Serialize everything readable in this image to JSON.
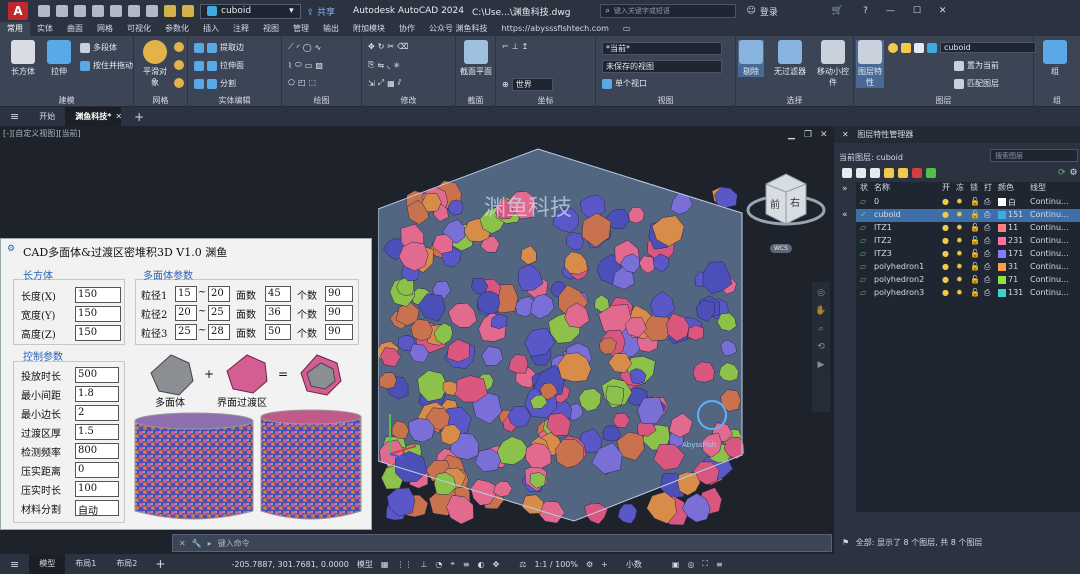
{
  "titlebar": {
    "logo": "A",
    "workspace": "cuboid",
    "share": "共享",
    "app_title": "Autodesk AutoCAD 2024",
    "file_path": "C:\\Use...\\渊鱼科技.dwg",
    "search_placeholder": "键入关键字或短语",
    "login": "登录"
  },
  "ribbon_tabs": [
    "常用",
    "实体",
    "曲面",
    "网格",
    "可视化",
    "参数化",
    "插入",
    "注释",
    "视图",
    "管理",
    "输出",
    "附加模块",
    "协作",
    "公众号 渊鱼科技",
    "https://abysssfishtech.com"
  ],
  "ribbon": {
    "groups": [
      {
        "label": "建模",
        "big": [
          "长方体",
          "拉伸"
        ],
        "small": [
          "多段体",
          "按住并拖动"
        ]
      },
      {
        "label": "网格",
        "big": [
          "平滑对象"
        ]
      },
      {
        "label": "实体编辑",
        "small": [
          "提取边",
          "拉伸面",
          "分割"
        ]
      },
      {
        "label": "绘图"
      },
      {
        "label": "修改"
      },
      {
        "label": "截面",
        "big": [
          "截面平面"
        ]
      },
      {
        "label": "坐标",
        "small": [
          "世界"
        ]
      },
      {
        "label": "视图",
        "small": [
          "*当前*",
          "未保存的视图",
          "单个视口"
        ]
      },
      {
        "label": "选择",
        "big": [
          "剔除",
          "无过滤器",
          "移动小控件"
        ]
      },
      {
        "label": "图层",
        "big": [
          "图层特性"
        ],
        "small": [
          "cuboid",
          "置为当前",
          "匹配图层"
        ]
      },
      {
        "label": "组",
        "big": [
          "组"
        ]
      }
    ]
  },
  "doc_tabs": [
    "开始",
    "渊鱼科技*"
  ],
  "viewport": {
    "label": "[-][自定义视图][当前]",
    "viewcube_front": "前",
    "viewcube_right": "右",
    "wcs": "WCS",
    "watermark": "渊鱼科技",
    "brand": "AbyssFish"
  },
  "panel": {
    "title": "CAD多面体&过渡区密堆积3D V1.0 渊鱼",
    "cuboid_title": "长方体",
    "length_label": "长度(X)",
    "length": "150",
    "width_label": "宽度(Y)",
    "width": "150",
    "height_label": "高度(Z)",
    "height": "150",
    "poly_title": "多面体参数",
    "rows": [
      {
        "label": "粒径1",
        "min": "15",
        "max": "20",
        "faces_label": "面数",
        "faces": "45",
        "count_label": "个数",
        "count": "90"
      },
      {
        "label": "粒径2",
        "min": "20",
        "max": "25",
        "faces_label": "面数",
        "faces": "36",
        "count_label": "个数",
        "count": "90"
      },
      {
        "label": "粒径3",
        "min": "25",
        "max": "28",
        "faces_label": "面数",
        "faces": "50",
        "count_label": "个数",
        "count": "90"
      }
    ],
    "tilde": "~",
    "ctrl_title": "控制参数",
    "controls": [
      {
        "label": "投放时长",
        "value": "500"
      },
      {
        "label": "最小间距",
        "value": "1.8"
      },
      {
        "label": "最小边长",
        "value": "2"
      },
      {
        "label": "过渡区厚",
        "value": "1.5"
      },
      {
        "label": "检测频率",
        "value": "800"
      },
      {
        "label": "压实距离",
        "value": "0"
      },
      {
        "label": "压实时长",
        "value": "100"
      },
      {
        "label": "材料分割",
        "value": "自动"
      }
    ],
    "plus": "+",
    "equals": "=",
    "cap_poly": "多面体",
    "cap_itz": "界面过渡区"
  },
  "layers": {
    "header": "图层特性管理器",
    "current": "当前图层: cuboid",
    "search": "搜索图层",
    "cols": [
      "状",
      "名称",
      "开",
      "冻",
      "锁",
      "打",
      "颜色",
      "线型"
    ],
    "items": [
      {
        "name": "0",
        "color": "白",
        "hex": "#ffffff",
        "ltype": "Continu...",
        "sel": false
      },
      {
        "name": "cuboid",
        "color": "151",
        "hex": "#3fa9e0",
        "ltype": "Continu...",
        "sel": true
      },
      {
        "name": "ITZ1",
        "color": "11",
        "hex": "#ff8080",
        "ltype": "Continu...",
        "sel": false
      },
      {
        "name": "ITZ2",
        "color": "231",
        "hex": "#ff6fa0",
        "ltype": "Continu...",
        "sel": false
      },
      {
        "name": "ITZ3",
        "color": "171",
        "hex": "#7f7fff",
        "ltype": "Continu...",
        "sel": false
      },
      {
        "name": "polyhedron1",
        "color": "31",
        "hex": "#ffa040",
        "ltype": "Continu...",
        "sel": false
      },
      {
        "name": "polyhedron2",
        "color": "71",
        "hex": "#8fe040",
        "ltype": "Continu...",
        "sel": false
      },
      {
        "name": "polyhedron3",
        "color": "131",
        "hex": "#40d0d0",
        "ltype": "Continu...",
        "sel": false
      }
    ],
    "footer": "全部: 显示了 8 个图层, 共 8 个图层"
  },
  "cmdline": {
    "placeholder": "键入命令"
  },
  "status": {
    "tabs": [
      "模型",
      "布局1",
      "布局2"
    ],
    "coords": "-205.7887, 301.7681, 0.0000",
    "mode": "模型",
    "scale": "1:1 / 100%",
    "units": "小数"
  }
}
